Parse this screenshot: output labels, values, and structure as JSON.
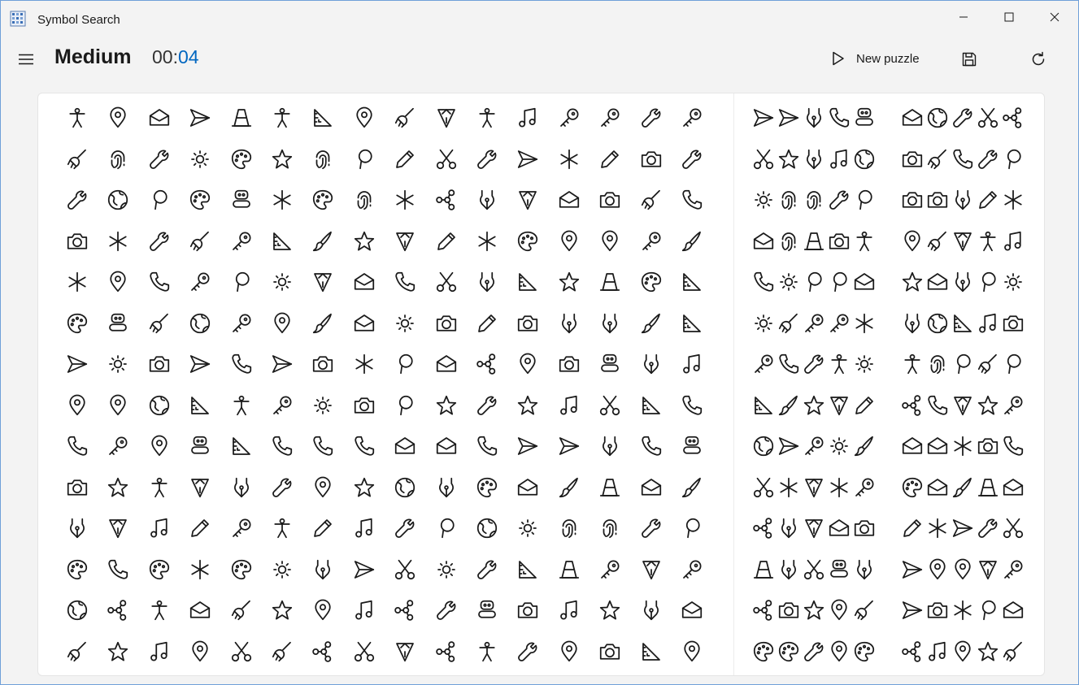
{
  "window": {
    "title": "Symbol Search",
    "controls": [
      "minimize-icon",
      "maximize-icon",
      "close-icon"
    ]
  },
  "header": {
    "difficulty": "Medium",
    "timer_minutes": "00:",
    "timer_seconds": "04",
    "new_puzzle_label": "New puzzle",
    "accent": "#0067c0"
  },
  "colors": {
    "accent": "#0067c0",
    "stroke": "#1a1a1a",
    "board": "#ffffff",
    "background": "#f3f3f3"
  },
  "grid": [
    [
      "person",
      "pin",
      "mail",
      "send",
      "cone",
      "person",
      "ruler",
      "pin",
      "broom",
      "pen",
      "person",
      "music",
      "key",
      "key",
      "wrench",
      "key"
    ],
    [
      "broom",
      "finger",
      "wrench",
      "sun",
      "palette",
      "star",
      "finger",
      "ballon",
      "pencil",
      "scissors",
      "wrench",
      "send",
      "asterisk",
      "pencil",
      "camera",
      "wrench"
    ],
    [
      "wrench",
      "globe",
      "ballon",
      "palette",
      "robot",
      "asterisk",
      "palette",
      "finger",
      "asterisk",
      "nodes",
      "nib",
      "pen",
      "mail",
      "camera",
      "broom",
      "phone"
    ],
    [
      "camera",
      "asterisk",
      "wrench",
      "broom",
      "key",
      "ruler",
      "brush",
      "star",
      "pen",
      "pencil",
      "asterisk",
      "palette",
      "pin",
      "pin",
      "key",
      "brush"
    ],
    [
      "asterisk",
      "pin",
      "phone",
      "key",
      "ballon",
      "sun",
      "pen",
      "mail",
      "phone",
      "scissors",
      "nib",
      "ruler",
      "star",
      "cone",
      "palette",
      "ruler"
    ],
    [
      "palette",
      "robot",
      "broom",
      "globe",
      "key",
      "pin",
      "brush",
      "mail",
      "sun",
      "camera",
      "pencil",
      "camera",
      "nib",
      "nib",
      "brush",
      "ruler"
    ],
    [
      "send",
      "sun",
      "camera",
      "send",
      "phone",
      "send",
      "camera",
      "asterisk",
      "ballon",
      "mail",
      "nodes",
      "pin",
      "camera",
      "robot",
      "nib",
      "music"
    ],
    [
      "pin",
      "pin",
      "globe",
      "ruler",
      "person",
      "key",
      "sun",
      "camera",
      "ballon",
      "star",
      "wrench",
      "star",
      "music",
      "scissors",
      "ruler",
      "phone"
    ],
    [
      "phone",
      "key",
      "pin",
      "robot",
      "ruler",
      "phone",
      "phone",
      "phone",
      "mail",
      "mail",
      "phone",
      "send",
      "send",
      "nib",
      "phone",
      "robot"
    ],
    [
      "camera",
      "star",
      "person",
      "pen",
      "nib",
      "wrench",
      "pin",
      "star",
      "globe",
      "nib",
      "palette",
      "mail",
      "brush",
      "cone",
      "mail",
      "brush"
    ],
    [
      "nib",
      "pen",
      "music",
      "pencil",
      "key",
      "person",
      "pencil",
      "music",
      "wrench",
      "ballon",
      "globe",
      "sun",
      "finger",
      "finger",
      "wrench",
      "ballon"
    ],
    [
      "palette",
      "phone",
      "palette",
      "asterisk",
      "palette",
      "sun",
      "nib",
      "send",
      "scissors",
      "sun",
      "wrench",
      "ruler",
      "cone",
      "key",
      "pen",
      "key"
    ],
    [
      "globe",
      "nodes",
      "person",
      "mail",
      "broom",
      "star",
      "pin",
      "music",
      "nodes",
      "wrench",
      "robot",
      "camera",
      "music",
      "star",
      "nib",
      "mail"
    ],
    [
      "broom",
      "star",
      "music",
      "pin",
      "scissors",
      "broom",
      "nodes",
      "scissors",
      "pen",
      "nodes",
      "person",
      "wrench",
      "pin",
      "camera",
      "ruler",
      "pin"
    ]
  ],
  "options": {
    "left": [
      [
        "send",
        "send",
        "nib",
        "phone",
        "robot"
      ],
      [
        "scissors",
        "star",
        "nib",
        "music",
        "globe"
      ],
      [
        "sun",
        "finger",
        "finger",
        "wrench",
        "ballon"
      ],
      [
        "mail",
        "finger",
        "cone",
        "camera",
        "person"
      ],
      [
        "phone",
        "sun",
        "ballon",
        "ballon",
        "mail"
      ],
      [
        "sun",
        "broom",
        "key",
        "key",
        "asterisk"
      ],
      [
        "key",
        "phone",
        "wrench",
        "person",
        "sun"
      ],
      [
        "ruler",
        "brush",
        "star",
        "pen",
        "pencil"
      ],
      [
        "globe",
        "send",
        "key",
        "sun",
        "brush"
      ],
      [
        "scissors",
        "asterisk",
        "pen",
        "asterisk",
        "key"
      ],
      [
        "nodes",
        "nib",
        "pen",
        "mail",
        "camera"
      ],
      [
        "cone",
        "nib",
        "scissors",
        "robot",
        "nib"
      ],
      [
        "nodes",
        "camera",
        "star",
        "pin",
        "broom"
      ],
      [
        "palette",
        "palette",
        "wrench",
        "pin",
        "palette"
      ]
    ],
    "right": [
      [
        "mail",
        "globe",
        "wrench",
        "scissors",
        "nodes"
      ],
      [
        "camera",
        "broom",
        "phone",
        "wrench",
        "ballon"
      ],
      [
        "camera",
        "camera",
        "nib",
        "pencil",
        "asterisk"
      ],
      [
        "pin",
        "broom",
        "pen",
        "person",
        "music"
      ],
      [
        "star",
        "mail",
        "nib",
        "ballon",
        "sun"
      ],
      [
        "nib",
        "globe",
        "ruler",
        "music",
        "camera"
      ],
      [
        "person",
        "finger",
        "ballon",
        "broom",
        "ballon"
      ],
      [
        "nodes",
        "phone",
        "pen",
        "star",
        "key"
      ],
      [
        "mail",
        "mail",
        "asterisk",
        "camera",
        "phone"
      ],
      [
        "palette",
        "mail",
        "brush",
        "cone",
        "mail"
      ],
      [
        "pencil",
        "asterisk",
        "send",
        "wrench",
        "scissors"
      ],
      [
        "send",
        "pin",
        "pin",
        "pen",
        "key"
      ],
      [
        "send",
        "camera",
        "asterisk",
        "ballon",
        "mail"
      ],
      [
        "nodes",
        "music",
        "pin",
        "star",
        "broom"
      ]
    ]
  }
}
